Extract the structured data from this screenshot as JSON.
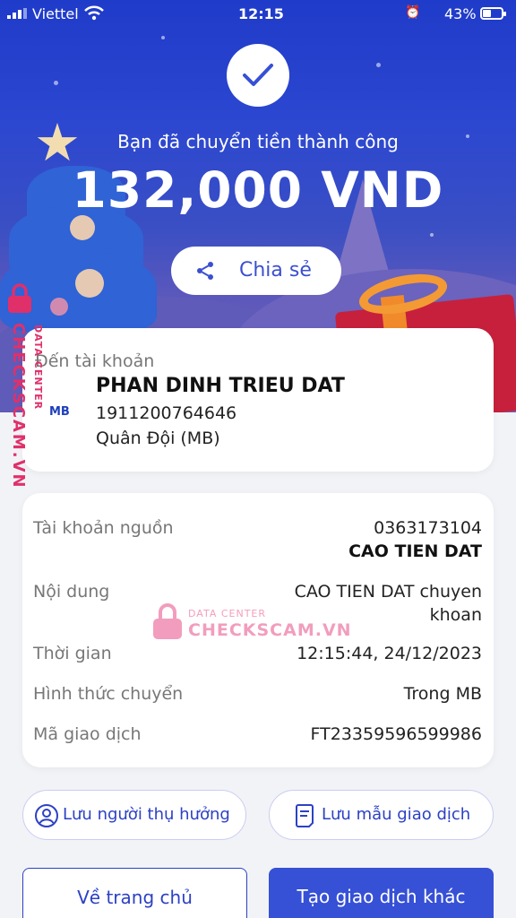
{
  "status_bar": {
    "carrier": "Viettel",
    "time": "12:15",
    "battery_text": "43%",
    "battery_level": 0.43
  },
  "hero": {
    "success_message": "Bạn đã chuyển tiền thành công",
    "amount": "132,000 VND",
    "share_label": "Chia sẻ"
  },
  "watermark": {
    "vertical_brand": "CHECKSCAM.VN",
    "vertical_sub": "DATA CENTER",
    "center_sub": "DATA CENTER",
    "center_brand": "CHECKSCAM.VN"
  },
  "recipient": {
    "label": "Đến tài khoản",
    "bank_logo": "MB",
    "name": "PHAN DINH TRIEU DAT",
    "account_number": "1911200764646",
    "bank_name": "Quân Đội (MB)"
  },
  "details": {
    "source_account_label": "Tài khoản nguồn",
    "source_account_number": "0363173104",
    "source_account_name": "CAO TIEN DAT",
    "content_label": "Nội dung",
    "content_line1": "CAO TIEN DAT chuyen",
    "content_line2": "khoan",
    "time_label": "Thời gian",
    "time_value": "12:15:44, 24/12/2023",
    "method_label": "Hình thức chuyển",
    "method_value": "Trong MB",
    "txn_label": "Mã giao dịch",
    "txn_value": "FT23359596599986"
  },
  "actions": {
    "save_recipient": "Lưu người thụ hưởng",
    "save_template": "Lưu mẫu giao dịch",
    "home": "Về trang chủ",
    "new_transaction": "Tạo giao dịch khác"
  },
  "colors": {
    "primary": "#3650d6",
    "hero_top": "#1f3bc9",
    "watermark": "#e0306a"
  }
}
